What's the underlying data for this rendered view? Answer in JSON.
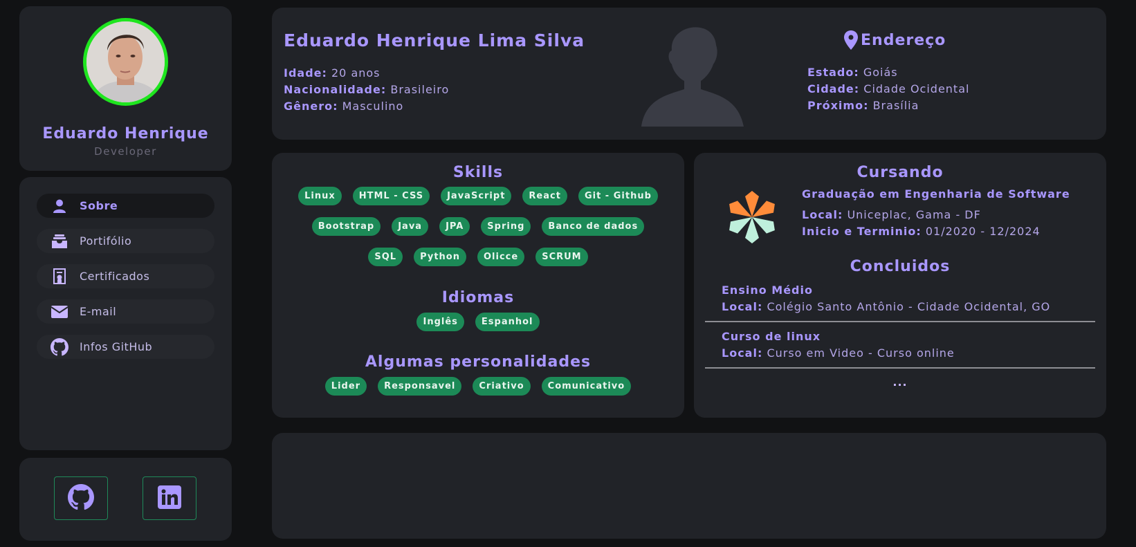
{
  "profile": {
    "name": "Eduardo Henrique",
    "role": "Developer"
  },
  "nav": {
    "items": [
      {
        "label": "Sobre",
        "icon": "user-icon"
      },
      {
        "label": "Portifólio",
        "icon": "inbox-icon"
      },
      {
        "label": "Certificados",
        "icon": "certificate-icon"
      },
      {
        "label": "E-mail",
        "icon": "envelope-icon"
      },
      {
        "label": "Infos GitHub",
        "icon": "github-icon"
      }
    ]
  },
  "social": {
    "github_icon": "github-icon",
    "linkedin_icon": "linkedin-icon"
  },
  "personal": {
    "full_name": "Eduardo Henrique Lima Silva",
    "age_label": "Idade:",
    "age_value": "20 anos",
    "nationality_label": "Nacionalidade:",
    "nationality_value": "Brasileiro",
    "gender_label": "Gênero:",
    "gender_value": "Masculino"
  },
  "address": {
    "title": "Endereço",
    "state_label": "Estado:",
    "state_value": "Goiás",
    "city_label": "Cidade:",
    "city_value": "Cidade Ocidental",
    "near_label": "Próximo:",
    "near_value": "Brasília"
  },
  "skills": {
    "title": "Skills",
    "rows": [
      [
        "Linux",
        "HTML - CSS",
        "JavaScript",
        "React",
        "Git - Github"
      ],
      [
        "Bootstrap",
        "Java",
        "JPA",
        "Spring",
        "Banco de dados"
      ],
      [
        "SQL",
        "Python",
        "Olicce",
        "SCRUM"
      ]
    ],
    "languages_title": "Idiomas",
    "languages": [
      "Inglês",
      "Espanhol"
    ],
    "traits_title": "Algumas personalidades",
    "traits": [
      "Lider",
      "Responsavel",
      "Criativo",
      "Comunicativo"
    ]
  },
  "education": {
    "current_title": "Cursando",
    "course": "Graduação em Engenharia de Software",
    "local_label": "Local:",
    "local_value": "Uniceplac, Gama - DF",
    "period_label": "Inicio e Terminio:",
    "period_value": "01/2020 - 12/2024",
    "done_title": "Concluidos",
    "done": [
      {
        "name": "Ensino Médio",
        "local_label": "Local:",
        "local_value": "Colégio Santo Antônio - Cidade Ocidental, GO"
      },
      {
        "name": "Curso de linux",
        "local_label": "Local:",
        "local_value": "Curso em Video - Curso online"
      }
    ],
    "more": "..."
  },
  "colors": {
    "accent": "#a997ff",
    "chip": "#1c8a57",
    "card": "#212328",
    "avatar_ring": "#1fe51f"
  }
}
